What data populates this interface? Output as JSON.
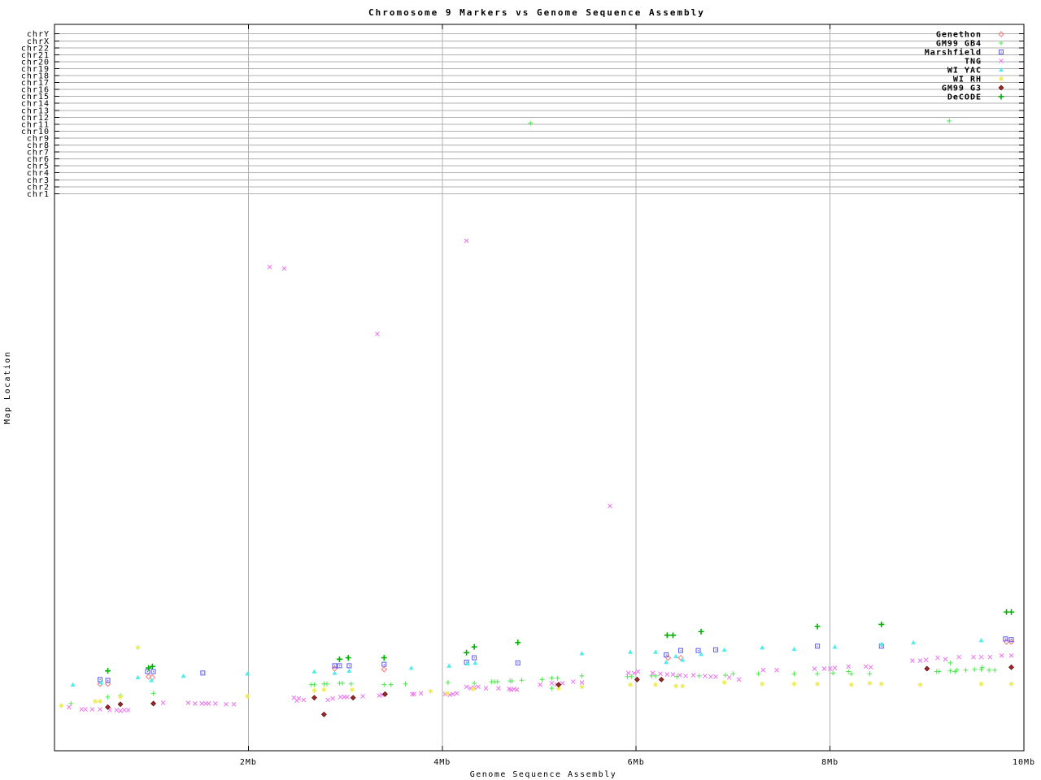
{
  "title": "Chromosome 9 Markers vs Genome Sequence Assembly",
  "x_axis": {
    "label": "Genome Sequence Assembly",
    "tick_labels": [
      "2Mb",
      "4Mb",
      "6Mb",
      "8Mb",
      "10Mb"
    ],
    "tick_values_mb": [
      2,
      4,
      6,
      8,
      10
    ]
  },
  "y_axis": {
    "label": "Map Location",
    "chromosome_ticks": [
      "chrY",
      "chrX",
      "chr22",
      "chr21",
      "chr20",
      "chr19",
      "chr18",
      "chr17",
      "chr16",
      "chr15",
      "chr14",
      "chr13",
      "chr12",
      "chr11",
      "chr10",
      "chr9",
      "chr8",
      "chr7",
      "chr6",
      "chr5",
      "chr4",
      "chr3",
      "chr2",
      "chr1"
    ]
  },
  "colors": {
    "frame": "#000000",
    "grid": "#b0b0b0",
    "background": "#ffffff"
  },
  "chart_data": {
    "type": "scatter",
    "title": "Chromosome 9 Markers vs Genome Sequence Assembly",
    "xlabel": "Genome Sequence Assembly",
    "ylabel": "Map Location",
    "xlim_mb": [
      0,
      10
    ],
    "x_unit": "Mb",
    "y_note": "y values are fraction of plot height above the bottom axis; y axis has no numeric scale, only chromosome boundary gridlines listed top-down in y_axis.chromosome_ticks",
    "grid": true,
    "legend_position": "top-right-inside",
    "series": [
      {
        "name": "Genethon",
        "color": "#f87878",
        "marker": "open-diamond",
        "points": [
          [
            0.47,
            0.092
          ],
          [
            0.55,
            0.092
          ],
          [
            0.97,
            0.102
          ],
          [
            1.01,
            0.101
          ],
          [
            2.89,
            0.113
          ],
          [
            3.4,
            0.112
          ],
          [
            6.33,
            0.128
          ],
          [
            6.46,
            0.128
          ],
          [
            9.82,
            0.15
          ],
          [
            9.87,
            0.15
          ]
        ]
      },
      {
        "name": "GM99 GB4",
        "color": "#50e850",
        "marker": "plus",
        "points": [
          [
            0.17,
            0.065
          ],
          [
            0.55,
            0.074
          ],
          [
            0.68,
            0.076
          ],
          [
            1.02,
            0.079
          ],
          [
            2.65,
            0.091
          ],
          [
            2.68,
            0.091
          ],
          [
            2.78,
            0.092
          ],
          [
            2.81,
            0.092
          ],
          [
            2.94,
            0.093
          ],
          [
            2.97,
            0.093
          ],
          [
            3.06,
            0.092
          ],
          [
            3.4,
            0.091
          ],
          [
            3.47,
            0.091
          ],
          [
            3.62,
            0.092
          ],
          [
            4.06,
            0.094
          ],
          [
            4.33,
            0.093
          ],
          [
            4.51,
            0.095
          ],
          [
            4.54,
            0.095
          ],
          [
            4.57,
            0.095
          ],
          [
            4.7,
            0.096
          ],
          [
            4.72,
            0.096
          ],
          [
            4.82,
            0.097
          ],
          [
            5.03,
            0.098
          ],
          [
            5.13,
            0.1
          ],
          [
            5.13,
            0.086
          ],
          [
            5.19,
            0.1
          ],
          [
            5.44,
            0.103
          ],
          [
            5.91,
            0.102
          ],
          [
            5.95,
            0.102
          ],
          [
            6.16,
            0.103
          ],
          [
            6.2,
            0.103
          ],
          [
            6.42,
            0.102
          ],
          [
            6.65,
            0.103
          ],
          [
            6.92,
            0.104
          ],
          [
            7.0,
            0.106
          ],
          [
            7.26,
            0.106
          ],
          [
            7.63,
            0.106
          ],
          [
            7.87,
            0.106
          ],
          [
            8.03,
            0.107
          ],
          [
            8.19,
            0.109
          ],
          [
            8.22,
            0.106
          ],
          [
            8.41,
            0.106
          ],
          [
            9.1,
            0.109
          ],
          [
            9.12,
            0.109
          ],
          [
            9.24,
            0.121
          ],
          [
            9.24,
            0.11
          ],
          [
            9.29,
            0.109
          ],
          [
            9.31,
            0.111
          ],
          [
            9.4,
            0.111
          ],
          [
            9.49,
            0.112
          ],
          [
            9.56,
            0.112
          ],
          [
            9.57,
            0.115
          ],
          [
            9.64,
            0.111
          ],
          [
            9.7,
            0.111
          ],
          [
            4.91,
            0.864
          ],
          [
            9.23,
            0.867
          ]
        ]
      },
      {
        "name": "Marshfield",
        "color": "#5858f8",
        "marker": "square-dot",
        "points": [
          [
            0.47,
            0.098
          ],
          [
            0.55,
            0.097
          ],
          [
            0.96,
            0.109
          ],
          [
            1.02,
            0.109
          ],
          [
            1.53,
            0.107
          ],
          [
            2.89,
            0.117
          ],
          [
            2.94,
            0.117
          ],
          [
            3.04,
            0.117
          ],
          [
            3.4,
            0.119
          ],
          [
            4.25,
            0.122
          ],
          [
            4.33,
            0.128
          ],
          [
            4.78,
            0.121
          ],
          [
            6.31,
            0.132
          ],
          [
            6.46,
            0.138
          ],
          [
            6.64,
            0.138
          ],
          [
            6.82,
            0.139
          ],
          [
            7.87,
            0.144
          ],
          [
            8.53,
            0.144
          ],
          [
            9.81,
            0.154
          ],
          [
            9.87,
            0.153
          ]
        ]
      },
      {
        "name": "TNG",
        "color": "#ee72ee",
        "marker": "x-cross",
        "points": [
          [
            0.15,
            0.06
          ],
          [
            0.28,
            0.057
          ],
          [
            0.32,
            0.057
          ],
          [
            0.39,
            0.057
          ],
          [
            0.47,
            0.057
          ],
          [
            0.57,
            0.056
          ],
          [
            0.64,
            0.056
          ],
          [
            0.68,
            0.055
          ],
          [
            0.72,
            0.056
          ],
          [
            0.76,
            0.056
          ],
          [
            1.12,
            0.066
          ],
          [
            1.38,
            0.066
          ],
          [
            1.45,
            0.065
          ],
          [
            1.52,
            0.065
          ],
          [
            1.56,
            0.065
          ],
          [
            1.59,
            0.065
          ],
          [
            1.66,
            0.065
          ],
          [
            1.77,
            0.064
          ],
          [
            1.85,
            0.064
          ],
          [
            2.47,
            0.073
          ],
          [
            2.5,
            0.069
          ],
          [
            2.52,
            0.072
          ],
          [
            2.57,
            0.07
          ],
          [
            2.82,
            0.07
          ],
          [
            2.87,
            0.072
          ],
          [
            2.95,
            0.074
          ],
          [
            2.99,
            0.074
          ],
          [
            3.02,
            0.074
          ],
          [
            3.18,
            0.075
          ],
          [
            3.35,
            0.076
          ],
          [
            3.38,
            0.077
          ],
          [
            3.69,
            0.078
          ],
          [
            3.71,
            0.078
          ],
          [
            3.78,
            0.079
          ],
          [
            4.03,
            0.078
          ],
          [
            4.08,
            0.077
          ],
          [
            4.11,
            0.078
          ],
          [
            4.15,
            0.079
          ],
          [
            4.25,
            0.088
          ],
          [
            4.29,
            0.086
          ],
          [
            4.33,
            0.087
          ],
          [
            4.37,
            0.088
          ],
          [
            4.45,
            0.086
          ],
          [
            4.58,
            0.086
          ],
          [
            4.69,
            0.085
          ],
          [
            4.71,
            0.084
          ],
          [
            4.74,
            0.085
          ],
          [
            4.77,
            0.084
          ],
          [
            5.01,
            0.091
          ],
          [
            5.13,
            0.093
          ],
          [
            5.18,
            0.091
          ],
          [
            5.24,
            0.093
          ],
          [
            5.35,
            0.095
          ],
          [
            5.44,
            0.094
          ],
          [
            5.92,
            0.107
          ],
          [
            5.98,
            0.107
          ],
          [
            6.02,
            0.109
          ],
          [
            6.17,
            0.107
          ],
          [
            6.25,
            0.106
          ],
          [
            6.32,
            0.105
          ],
          [
            6.38,
            0.105
          ],
          [
            6.45,
            0.104
          ],
          [
            6.51,
            0.103
          ],
          [
            6.59,
            0.104
          ],
          [
            6.71,
            0.103
          ],
          [
            6.77,
            0.102
          ],
          [
            6.82,
            0.102
          ],
          [
            6.96,
            0.101
          ],
          [
            7.06,
            0.098
          ],
          [
            7.31,
            0.111
          ],
          [
            7.45,
            0.111
          ],
          [
            7.84,
            0.113
          ],
          [
            7.94,
            0.113
          ],
          [
            8.0,
            0.113
          ],
          [
            8.05,
            0.114
          ],
          [
            8.19,
            0.116
          ],
          [
            8.37,
            0.116
          ],
          [
            8.42,
            0.115
          ],
          [
            8.85,
            0.124
          ],
          [
            8.93,
            0.124
          ],
          [
            8.99,
            0.125
          ],
          [
            9.11,
            0.128
          ],
          [
            9.19,
            0.126
          ],
          [
            9.33,
            0.129
          ],
          [
            9.48,
            0.129
          ],
          [
            9.56,
            0.129
          ],
          [
            9.65,
            0.129
          ],
          [
            9.77,
            0.131
          ],
          [
            9.87,
            0.131
          ],
          [
            2.22,
            0.666
          ],
          [
            2.37,
            0.664
          ],
          [
            4.25,
            0.702
          ],
          [
            3.33,
            0.574
          ],
          [
            5.73,
            0.337
          ]
        ]
      },
      {
        "name": "WI YAC",
        "color": "#50ecec",
        "marker": "triangle",
        "points": [
          [
            0.19,
            0.091
          ],
          [
            0.48,
            0.094
          ],
          [
            0.86,
            0.101
          ],
          [
            1.0,
            0.097
          ],
          [
            1.33,
            0.103
          ],
          [
            1.99,
            0.106
          ],
          [
            2.68,
            0.109
          ],
          [
            2.89,
            0.107
          ],
          [
            3.04,
            0.11
          ],
          [
            3.68,
            0.114
          ],
          [
            4.07,
            0.117
          ],
          [
            4.26,
            0.12
          ],
          [
            4.34,
            0.121
          ],
          [
            5.44,
            0.134
          ],
          [
            5.94,
            0.136
          ],
          [
            6.2,
            0.136
          ],
          [
            6.31,
            0.122
          ],
          [
            6.41,
            0.13
          ],
          [
            6.48,
            0.125
          ],
          [
            6.67,
            0.133
          ],
          [
            6.91,
            0.139
          ],
          [
            7.3,
            0.142
          ],
          [
            7.63,
            0.14
          ],
          [
            8.05,
            0.143
          ],
          [
            8.53,
            0.147
          ],
          [
            8.86,
            0.149
          ],
          [
            9.56,
            0.152
          ]
        ]
      },
      {
        "name": "WI RH",
        "color": "#ecec50",
        "marker": "asterisk",
        "points": [
          [
            0.86,
            0.142
          ],
          [
            0.07,
            0.062
          ],
          [
            0.42,
            0.068
          ],
          [
            0.47,
            0.068
          ],
          [
            0.68,
            0.074
          ],
          [
            1.99,
            0.075
          ],
          [
            2.68,
            0.083
          ],
          [
            2.78,
            0.084
          ],
          [
            3.07,
            0.084
          ],
          [
            3.88,
            0.082
          ],
          [
            4.05,
            0.079
          ],
          [
            4.32,
            0.085
          ],
          [
            5.2,
            0.086
          ],
          [
            5.44,
            0.088
          ],
          [
            5.94,
            0.091
          ],
          [
            6.2,
            0.091
          ],
          [
            6.41,
            0.089
          ],
          [
            6.48,
            0.089
          ],
          [
            6.91,
            0.094
          ],
          [
            7.3,
            0.092
          ],
          [
            7.63,
            0.092
          ],
          [
            7.87,
            0.092
          ],
          [
            8.22,
            0.091
          ],
          [
            8.41,
            0.093
          ],
          [
            8.53,
            0.092
          ],
          [
            8.93,
            0.091
          ],
          [
            9.56,
            0.092
          ],
          [
            9.87,
            0.092
          ]
        ]
      },
      {
        "name": "GM99 G3",
        "color": "#a02828",
        "marker": "filled-diamond",
        "points": [
          [
            0.55,
            0.06
          ],
          [
            0.68,
            0.064
          ],
          [
            1.02,
            0.065
          ],
          [
            2.68,
            0.073
          ],
          [
            2.78,
            0.05
          ],
          [
            3.08,
            0.073
          ],
          [
            3.41,
            0.078
          ],
          [
            5.2,
            0.091
          ],
          [
            6.01,
            0.098
          ],
          [
            6.26,
            0.098
          ],
          [
            9.0,
            0.113
          ],
          [
            9.87,
            0.115
          ]
        ]
      },
      {
        "name": "DeCODE",
        "color": "#00b000",
        "marker": "plus-bold",
        "points": [
          [
            0.55,
            0.11
          ],
          [
            0.97,
            0.114
          ],
          [
            1.01,
            0.116
          ],
          [
            2.94,
            0.126
          ],
          [
            3.03,
            0.128
          ],
          [
            3.4,
            0.128
          ],
          [
            4.25,
            0.135
          ],
          [
            4.33,
            0.143
          ],
          [
            4.78,
            0.149
          ],
          [
            6.32,
            0.159
          ],
          [
            6.38,
            0.159
          ],
          [
            6.67,
            0.164
          ],
          [
            7.87,
            0.171
          ],
          [
            8.53,
            0.174
          ],
          [
            9.82,
            0.191
          ],
          [
            9.87,
            0.191
          ]
        ]
      }
    ]
  }
}
